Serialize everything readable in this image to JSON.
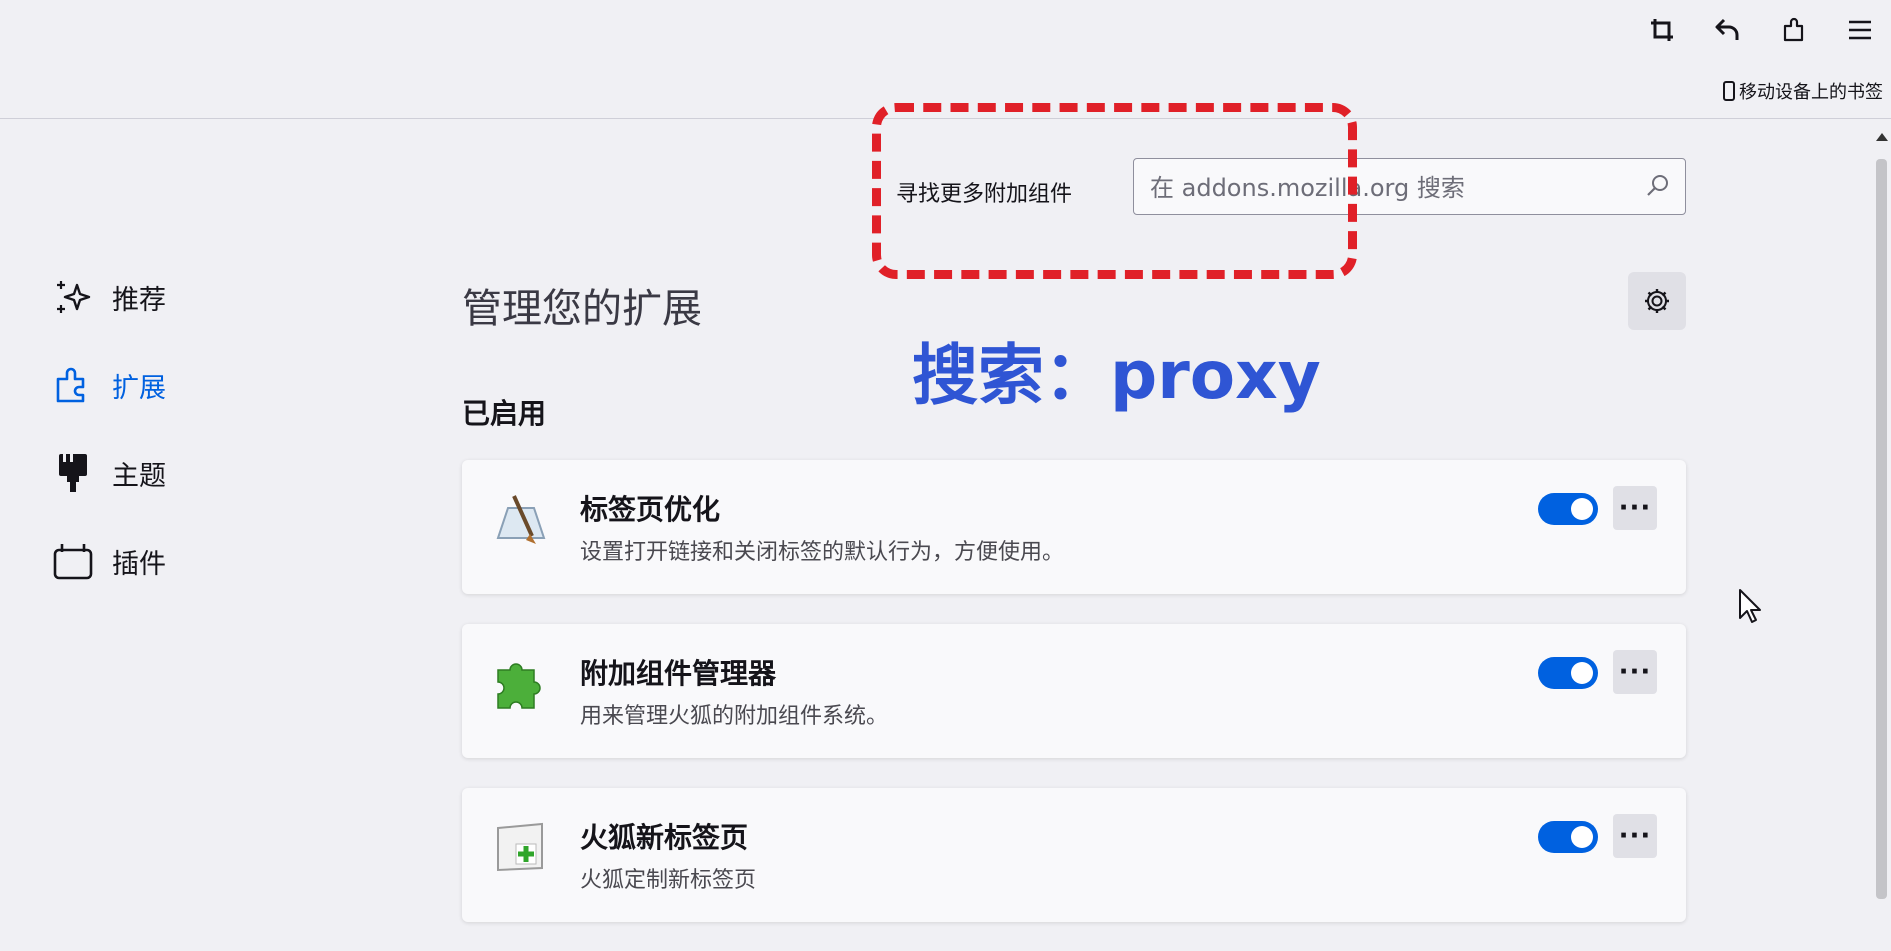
{
  "toolbar": {
    "icons": [
      "crop-icon",
      "undo-icon",
      "extensions-icon",
      "menu-icon"
    ],
    "mobile_bookmarks_label": "移动设备上的书签"
  },
  "search": {
    "label": "寻找更多附加组件",
    "placeholder": "在 addons.mozilla.org 搜索"
  },
  "annotation": {
    "text": "搜索：proxy",
    "color": "#2f55d4",
    "box_color": "#e02028"
  },
  "sidebar": {
    "items": [
      {
        "label": "推荐",
        "icon": "sparkle-icon",
        "active": false
      },
      {
        "label": "扩展",
        "icon": "puzzle-icon",
        "active": true
      },
      {
        "label": "主题",
        "icon": "brush-icon",
        "active": false
      },
      {
        "label": "插件",
        "icon": "plugin-icon",
        "active": false
      }
    ]
  },
  "main": {
    "title": "管理您的扩展",
    "enabled_heading": "已启用",
    "extensions": [
      {
        "name": "标签页优化",
        "description": "设置打开链接和关闭标签的默认行为，方便使用。",
        "enabled": true,
        "icon": "tab-optimizer-icon",
        "more": "···"
      },
      {
        "name": "附加组件管理器",
        "description": "用来管理火狐的附加组件系统。",
        "enabled": true,
        "icon": "green-puzzle-icon",
        "more": "···"
      },
      {
        "name": "火狐新标签页",
        "description": "火狐定制新标签页",
        "enabled": true,
        "icon": "new-tab-icon",
        "more": "···"
      }
    ]
  },
  "colors": {
    "accent": "#0061e0",
    "background": "#f0f0f4",
    "card": "#f9f9fb"
  }
}
